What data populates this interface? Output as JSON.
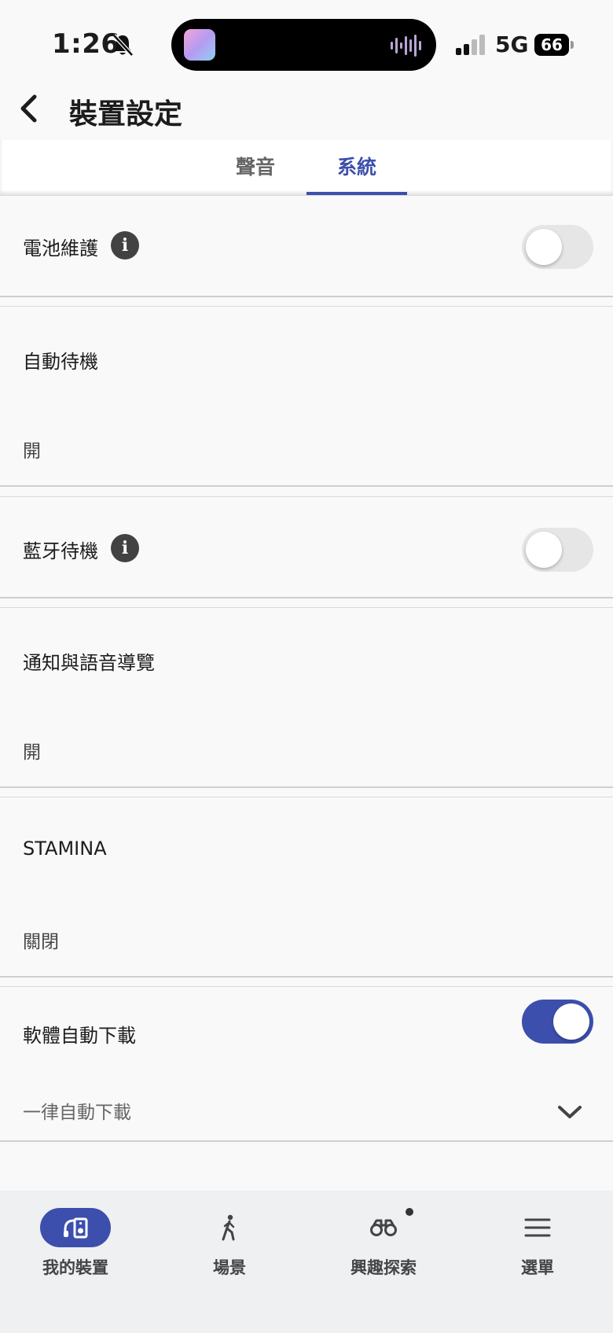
{
  "status_bar": {
    "time": "1:26",
    "network": "5G",
    "battery": "66"
  },
  "header": {
    "title": "裝置設定"
  },
  "tabs": [
    {
      "label": "聲音",
      "active": false
    },
    {
      "label": "系統",
      "active": true
    }
  ],
  "settings": {
    "battery_care": {
      "label": "電池維護",
      "toggle": false
    },
    "auto_standby": {
      "label": "自動待機",
      "value": "開"
    },
    "bt_standby": {
      "label": "藍牙待機",
      "toggle": false
    },
    "voice_guidance": {
      "label": "通知與語音導覽",
      "value": "開"
    },
    "stamina": {
      "label": "STAMINA",
      "value": "關閉"
    },
    "auto_download": {
      "label": "軟體自動下載",
      "toggle": true,
      "option": "一律自動下載"
    }
  },
  "bottom_nav": [
    {
      "label": "我的裝置",
      "icon": "device-icon",
      "active": true
    },
    {
      "label": "場景",
      "icon": "walking-icon",
      "active": false
    },
    {
      "label": "興趣探索",
      "icon": "binoculars-icon",
      "active": false
    },
    {
      "label": "選單",
      "icon": "menu-icon",
      "active": false
    }
  ],
  "colors": {
    "accent": "#3d4fad",
    "background": "#f9f9f9",
    "nav_background": "#eef0f2"
  }
}
